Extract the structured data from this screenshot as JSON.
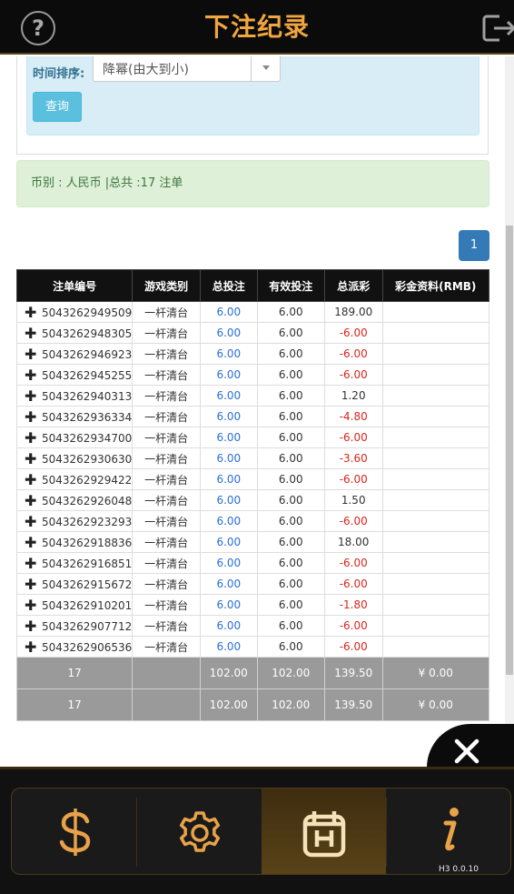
{
  "header": {
    "title": "下注纪录",
    "help_icon": "question-circle-icon",
    "logout_icon": "logout-icon"
  },
  "filter": {
    "sort_label": "时间排序:",
    "sort_value": "降幂(由大到小)",
    "query_label": "查询"
  },
  "summary_text": "币别 : 人民币 |总共 :17 注单",
  "pagination": {
    "current": "1"
  },
  "table": {
    "headers": [
      "注单编号",
      "游戏类别",
      "总投注",
      "有效投注",
      "总派彩",
      "彩金资料(RMB)"
    ],
    "rows": [
      {
        "id": "5043262949509",
        "game": "一杆清台",
        "bet": "6.00",
        "valid": "6.00",
        "payout": "189.00",
        "jackpot": ""
      },
      {
        "id": "5043262948305",
        "game": "一杆清台",
        "bet": "6.00",
        "valid": "6.00",
        "payout": "-6.00",
        "jackpot": ""
      },
      {
        "id": "5043262946923",
        "game": "一杆清台",
        "bet": "6.00",
        "valid": "6.00",
        "payout": "-6.00",
        "jackpot": ""
      },
      {
        "id": "5043262945255",
        "game": "一杆清台",
        "bet": "6.00",
        "valid": "6.00",
        "payout": "-6.00",
        "jackpot": ""
      },
      {
        "id": "5043262940313",
        "game": "一杆清台",
        "bet": "6.00",
        "valid": "6.00",
        "payout": "1.20",
        "jackpot": ""
      },
      {
        "id": "5043262936334",
        "game": "一杆清台",
        "bet": "6.00",
        "valid": "6.00",
        "payout": "-4.80",
        "jackpot": ""
      },
      {
        "id": "5043262934700",
        "game": "一杆清台",
        "bet": "6.00",
        "valid": "6.00",
        "payout": "-6.00",
        "jackpot": ""
      },
      {
        "id": "5043262930630",
        "game": "一杆清台",
        "bet": "6.00",
        "valid": "6.00",
        "payout": "-3.60",
        "jackpot": ""
      },
      {
        "id": "5043262929422",
        "game": "一杆清台",
        "bet": "6.00",
        "valid": "6.00",
        "payout": "-6.00",
        "jackpot": ""
      },
      {
        "id": "5043262926048",
        "game": "一杆清台",
        "bet": "6.00",
        "valid": "6.00",
        "payout": "1.50",
        "jackpot": ""
      },
      {
        "id": "5043262923293",
        "game": "一杆清台",
        "bet": "6.00",
        "valid": "6.00",
        "payout": "-6.00",
        "jackpot": ""
      },
      {
        "id": "5043262918836",
        "game": "一杆清台",
        "bet": "6.00",
        "valid": "6.00",
        "payout": "18.00",
        "jackpot": ""
      },
      {
        "id": "5043262916851",
        "game": "一杆清台",
        "bet": "6.00",
        "valid": "6.00",
        "payout": "-6.00",
        "jackpot": ""
      },
      {
        "id": "5043262915672",
        "game": "一杆清台",
        "bet": "6.00",
        "valid": "6.00",
        "payout": "-6.00",
        "jackpot": ""
      },
      {
        "id": "5043262910201",
        "game": "一杆清台",
        "bet": "6.00",
        "valid": "6.00",
        "payout": "-1.80",
        "jackpot": ""
      },
      {
        "id": "5043262907712",
        "game": "一杆清台",
        "bet": "6.00",
        "valid": "6.00",
        "payout": "-6.00",
        "jackpot": ""
      },
      {
        "id": "5043262906536",
        "game": "一杆清台",
        "bet": "6.00",
        "valid": "6.00",
        "payout": "-6.00",
        "jackpot": ""
      }
    ],
    "totals": [
      {
        "count": "17",
        "game": "",
        "bet": "102.00",
        "valid": "102.00",
        "payout": "139.50",
        "jackpot": "¥ 0.00"
      },
      {
        "count": "17",
        "game": "",
        "bet": "102.00",
        "valid": "102.00",
        "payout": "139.50",
        "jackpot": "¥ 0.00"
      }
    ]
  },
  "footer": {
    "nav": [
      {
        "icon": "dollar-icon",
        "active": false
      },
      {
        "icon": "gear-icon",
        "active": false
      },
      {
        "icon": "history-calendar-icon",
        "active": true
      },
      {
        "icon": "info-icon",
        "active": false
      }
    ],
    "version": "H3 0.0.10",
    "close_icon": "close-icon"
  },
  "colors": {
    "accent": "#f0a640",
    "header_bg": "#0b0b0b",
    "negative": "#d9261c",
    "bet_blue": "#2a6fd6",
    "page_btn": "#337ab7"
  }
}
